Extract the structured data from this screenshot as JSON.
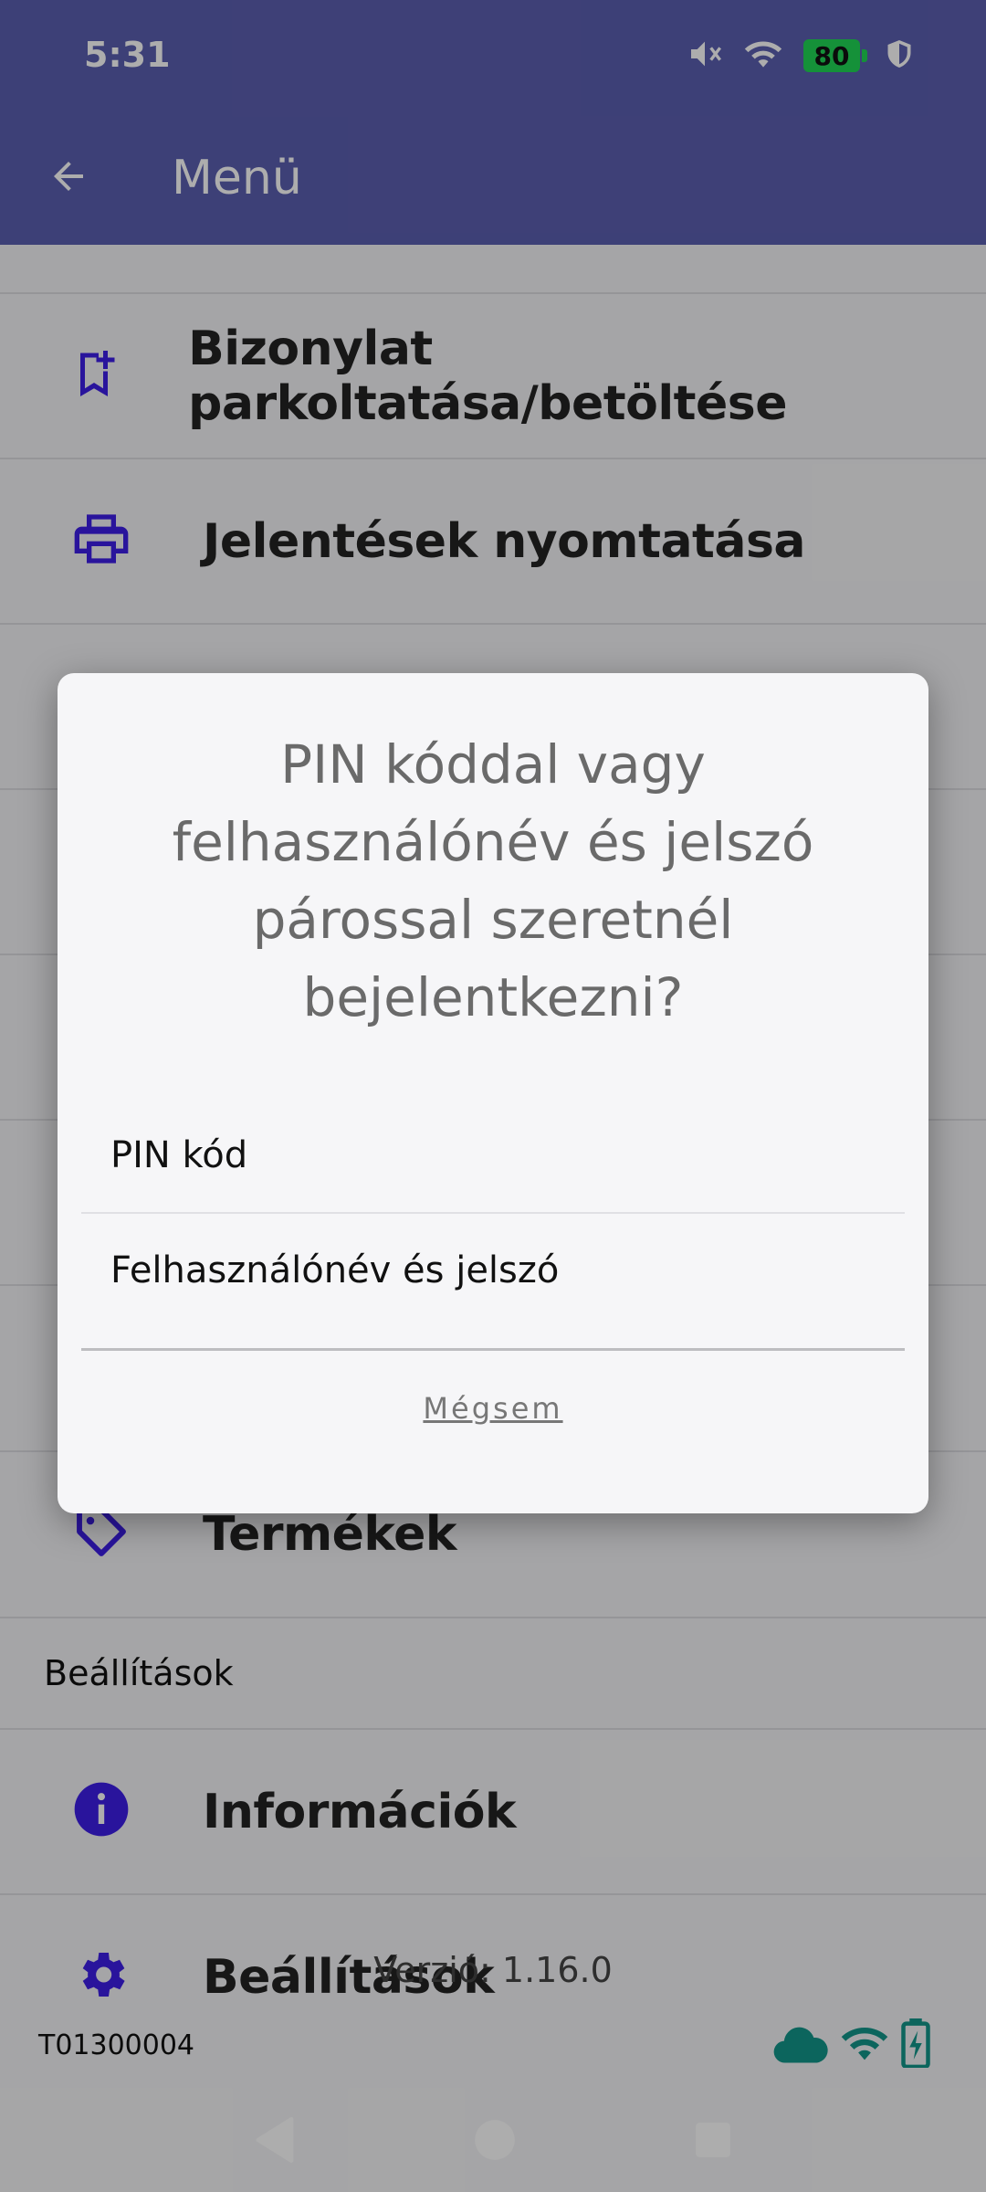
{
  "status_bar": {
    "time": "5:31",
    "battery_level": "80",
    "icons": [
      "mute-icon",
      "wifi-icon",
      "battery-icon",
      "shield-icon"
    ]
  },
  "app_bar": {
    "title": "Menü",
    "back_icon": "arrow-back-icon"
  },
  "menu": {
    "items": [
      {
        "label": "Bizonylat parkoltatása/betöltése",
        "icon": "bookmark-add-icon"
      },
      {
        "label": "Jelentések nyomtatása",
        "icon": "printer-icon"
      },
      {
        "label": "Termékek",
        "icon": "tag-icon"
      }
    ],
    "section_header": "Beállítások",
    "settings_items": [
      {
        "label": "Információk",
        "icon": "info-icon"
      },
      {
        "label": "Beállítások",
        "icon": "gear-icon"
      }
    ]
  },
  "footer": {
    "version": "Verzió: 1.16.0",
    "device_id": "T01300004",
    "connection_icons": [
      "cloud-icon",
      "wifi-icon",
      "battery-charging-icon"
    ]
  },
  "dialog": {
    "title": "PIN kóddal vagy felhasználónév és jelszó párossal szeretnél bejelentkezni?",
    "options": [
      "PIN kód",
      "Felhasználónév és jelszó"
    ],
    "cancel_label": "Mégsem"
  },
  "colors": {
    "app_bar": "#5b5fb0",
    "icon_purple": "#3d1ee6",
    "connection_teal": "#12968a",
    "battery_green": "#1fd655"
  }
}
